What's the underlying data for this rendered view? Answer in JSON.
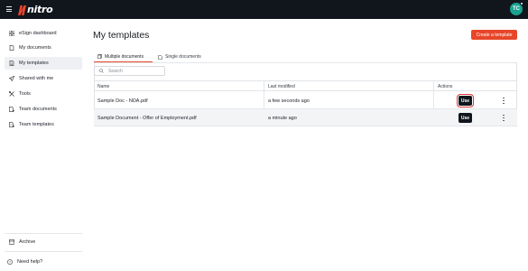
{
  "header": {
    "logo_text": "nitro",
    "avatar_initials": "TC",
    "brand_color": "#e8462a"
  },
  "sidebar": {
    "items": [
      {
        "label": "eSign dashboard",
        "icon": "grid-icon"
      },
      {
        "label": "My documents",
        "icon": "document-icon"
      },
      {
        "label": "My templates",
        "icon": "template-icon",
        "active": true
      },
      {
        "label": "Shared with me",
        "icon": "send-icon"
      },
      {
        "label": "Tools",
        "icon": "tools-icon"
      },
      {
        "label": "Team documents",
        "icon": "team-document-icon"
      },
      {
        "label": "Team templates",
        "icon": "team-template-icon"
      }
    ],
    "archive_label": "Archive",
    "help_label": "Need help?"
  },
  "main": {
    "title": "My templates",
    "create_button": "Create a template",
    "tabs": [
      {
        "label": "Multiple documents",
        "active": true
      },
      {
        "label": "Single documents",
        "active": false
      }
    ],
    "search": {
      "placeholder": "Search",
      "value": ""
    },
    "table": {
      "columns": [
        "Name",
        "Last modified",
        "Actions"
      ],
      "rows": [
        {
          "name": "Sample Doc - NDA.pdf",
          "modified": "a few seconds ago",
          "action": "Use"
        },
        {
          "name": "Sample Document - Offer of Employment.pdf",
          "modified": "a minute ago",
          "action": "Use"
        }
      ]
    }
  }
}
